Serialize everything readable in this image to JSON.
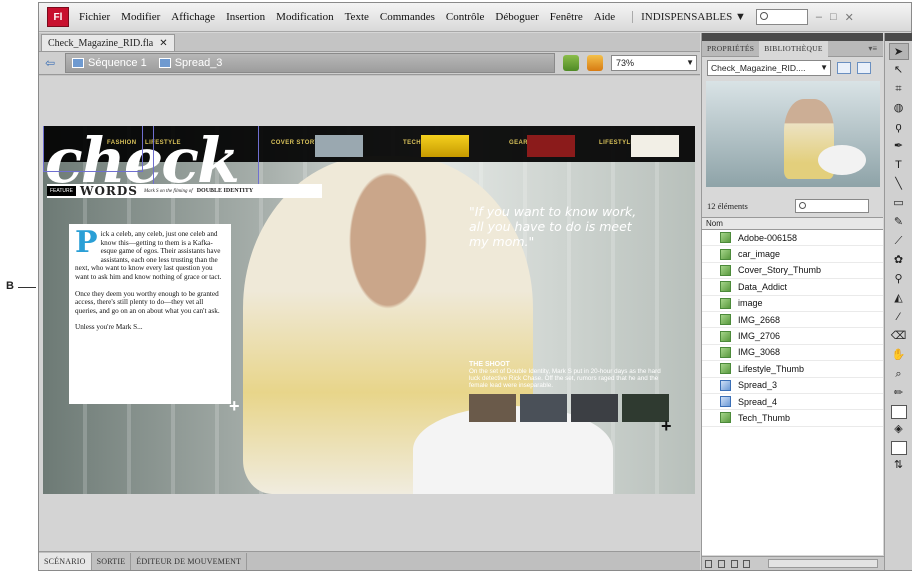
{
  "callout": "B",
  "menu": {
    "logo": "Fl",
    "items": [
      "Fichier",
      "Modifier",
      "Affichage",
      "Insertion",
      "Modification",
      "Texte",
      "Commandes",
      "Contrôle",
      "Déboguer",
      "Fenêtre",
      "Aide"
    ],
    "workspace": "INDISPENSABLES ▼",
    "controls": [
      "–",
      "□",
      "✕"
    ]
  },
  "document": {
    "tab_title": "Check_Magazine_RID.fla",
    "tab_close": "✕",
    "breadcrumbs": [
      "Séquence 1",
      "Spread_3"
    ],
    "zoom": "73%"
  },
  "page": {
    "logo": "check",
    "nav": [
      {
        "label": "FASHION"
      },
      {
        "label": "LIFESTYLE"
      },
      {
        "label": "COVER STORY"
      },
      {
        "label": "TECH"
      },
      {
        "label": "GEAR"
      },
      {
        "label": "LIFESTYLE"
      }
    ],
    "feature_tag": "FEATURE",
    "words": "WORDS",
    "byline": "Mark S on the filming of",
    "title": "DOUBLE IDENTITY",
    "dropcap": "P",
    "paragraphs": [
      "ick a celeb, any celeb, just one celeb and know this—getting to them is a Kafka-esque game of egos. Their assistants have assistants, each one less trusting than the next, who want to know every last question you want to ask him and know nothing of grace or tact.",
      "Once they deem you worthy enough to be granted access, there's still plenty to do—they vet all queries, and go on an on about what you can't ask.",
      "Unless you're Mark S..."
    ],
    "quote": "\"If you want to know work, all you have to do is meet my mom.\"",
    "shoot_title": "THE SHOOT",
    "shoot_text": "On the set of Double Identity, Mark S put in 20-hour days as the hard luck detective Rick Chase. Off the set, rumors raged that he and the female lead were inseparable."
  },
  "bottom_tabs": [
    "SCÉNARIO",
    "SORTIE",
    "ÉDITEUR DE MOUVEMENT"
  ],
  "panel": {
    "tabs": [
      "PROPRIÉTÉS",
      "BIBLIOTHÈQUE"
    ],
    "library_name": "Check_Magazine_RID....",
    "count": "12 éléments",
    "column": "Nom",
    "items": [
      {
        "label": "Adobe-006158",
        "type": "bitmap"
      },
      {
        "label": "car_image",
        "type": "bitmap"
      },
      {
        "label": "Cover_Story_Thumb",
        "type": "bitmap"
      },
      {
        "label": "Data_Addict",
        "type": "bitmap"
      },
      {
        "label": "image",
        "type": "bitmap"
      },
      {
        "label": "IMG_2668",
        "type": "bitmap"
      },
      {
        "label": "IMG_2706",
        "type": "bitmap"
      },
      {
        "label": "IMG_3068",
        "type": "bitmap"
      },
      {
        "label": "Lifestyle_Thumb",
        "type": "bitmap"
      },
      {
        "label": "Spread_3",
        "type": "symbol"
      },
      {
        "label": "Spread_4",
        "type": "symbol"
      },
      {
        "label": "Tech_Thumb",
        "type": "bitmap"
      }
    ]
  },
  "tools": {
    "icons": [
      "selection-icon",
      "subselection-icon",
      "free-transform-icon",
      "3d-rotation-icon",
      "lasso-icon",
      "pen-icon",
      "text-icon",
      "line-icon",
      "rectangle-icon",
      "pencil-icon",
      "brush-icon",
      "deco-icon",
      "bone-icon",
      "paint-bucket-icon",
      "eyedropper-icon",
      "eraser-icon",
      "hand-icon",
      "zoom-icon"
    ]
  }
}
